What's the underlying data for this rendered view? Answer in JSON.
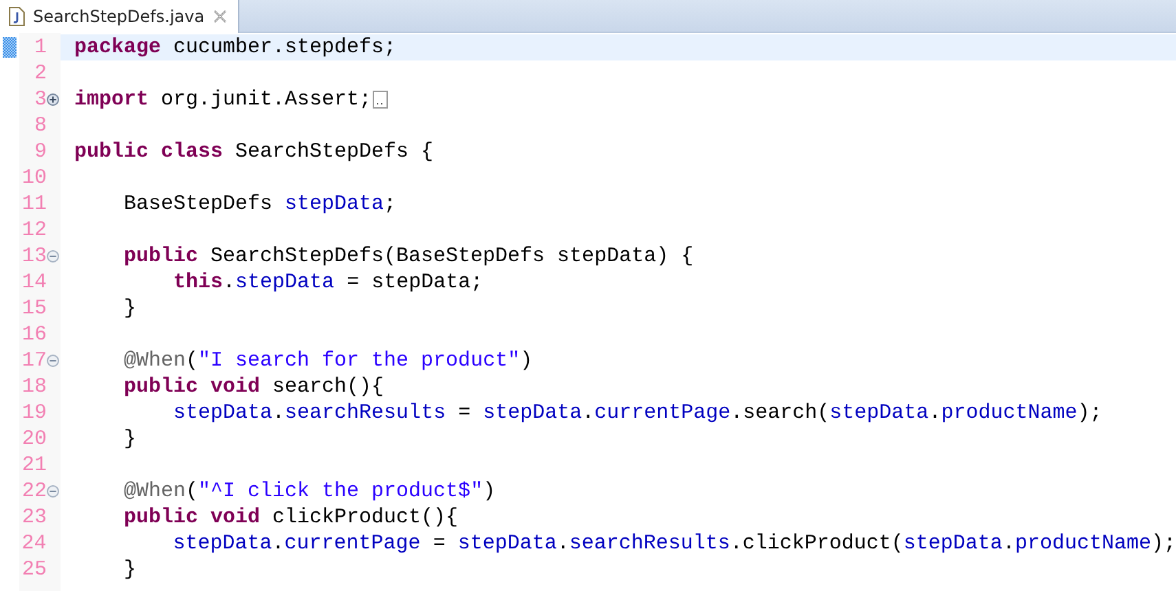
{
  "tabs": [
    {
      "title": "SearchStepDefs.java",
      "selected": true
    }
  ],
  "lines": [
    {
      "number": "1",
      "current": true,
      "tokens": [
        {
          "kind": "keyword",
          "text": "package"
        },
        {
          "kind": "plain",
          "text": " cucumber.stepdefs;"
        }
      ]
    },
    {
      "number": "2",
      "current": false
    },
    {
      "number": "3",
      "current": false,
      "collapsed": true,
      "tokens": [
        {
          "kind": "keyword",
          "text": "import"
        },
        {
          "kind": "plain",
          "text": " org.junit.Assert;"
        }
      ]
    },
    {
      "number": "8",
      "current": false
    },
    {
      "number": "9",
      "current": false,
      "tokens": [
        {
          "kind": "keyword",
          "text": "public class"
        },
        {
          "kind": "plain",
          "text": " SearchStepDefs {"
        }
      ]
    },
    {
      "number": "10",
      "current": false
    },
    {
      "number": "11",
      "current": false,
      "tokens": [
        {
          "kind": "plain",
          "text": "    BaseStepDefs "
        },
        {
          "kind": "field",
          "text": "stepData"
        },
        {
          "kind": "plain",
          "text": ";"
        }
      ]
    },
    {
      "number": "12",
      "current": false
    },
    {
      "number": "13",
      "current": false,
      "collapsed": false,
      "tokens": [
        {
          "kind": "keyword",
          "text": "    public"
        },
        {
          "kind": "plain",
          "text": " SearchStepDefs(BaseStepDefs stepData) {"
        }
      ]
    },
    {
      "number": "14",
      "current": false,
      "tokens": [
        {
          "kind": "keyword",
          "text": "        this"
        },
        {
          "kind": "plain",
          "text": "."
        },
        {
          "kind": "field",
          "text": "stepData"
        },
        {
          "kind": "plain",
          "text": " = stepData;"
        }
      ]
    },
    {
      "number": "15",
      "current": false,
      "tokens": [
        {
          "kind": "plain",
          "text": "    }"
        }
      ]
    },
    {
      "number": "16",
      "current": false
    },
    {
      "number": "17",
      "current": false,
      "collapsed": false,
      "tokens": [
        {
          "kind": "annotation",
          "text": "    @When"
        },
        {
          "kind": "plain",
          "text": "("
        },
        {
          "kind": "string",
          "text": "\"I search for the product\""
        },
        {
          "kind": "plain",
          "text": ")"
        }
      ]
    },
    {
      "number": "18",
      "current": false,
      "tokens": [
        {
          "kind": "keyword",
          "text": "    public void"
        },
        {
          "kind": "plain",
          "text": " search(){"
        }
      ]
    },
    {
      "number": "19",
      "current": false,
      "tokens": [
        {
          "kind": "field",
          "text": "        stepData"
        },
        {
          "kind": "plain",
          "text": "."
        },
        {
          "kind": "field",
          "text": "searchResults"
        },
        {
          "kind": "plain",
          "text": " = "
        },
        {
          "kind": "field",
          "text": "stepData"
        },
        {
          "kind": "plain",
          "text": "."
        },
        {
          "kind": "field",
          "text": "currentPage"
        },
        {
          "kind": "plain",
          "text": ".search("
        },
        {
          "kind": "field",
          "text": "stepData"
        },
        {
          "kind": "plain",
          "text": "."
        },
        {
          "kind": "field",
          "text": "productName"
        },
        {
          "kind": "plain",
          "text": ");"
        }
      ]
    },
    {
      "number": "20",
      "current": false,
      "tokens": [
        {
          "kind": "plain",
          "text": "    }"
        }
      ]
    },
    {
      "number": "21",
      "current": false
    },
    {
      "number": "22",
      "current": false,
      "collapsed": false,
      "tokens": [
        {
          "kind": "annotation",
          "text": "    @When"
        },
        {
          "kind": "plain",
          "text": "("
        },
        {
          "kind": "string",
          "text": "\"^I click the product$\""
        },
        {
          "kind": "plain",
          "text": ")"
        }
      ]
    },
    {
      "number": "23",
      "current": false,
      "tokens": [
        {
          "kind": "keyword",
          "text": "    public void"
        },
        {
          "kind": "plain",
          "text": " clickProduct(){"
        }
      ]
    },
    {
      "number": "24",
      "current": false,
      "tokens": [
        {
          "kind": "field",
          "text": "        stepData"
        },
        {
          "kind": "plain",
          "text": "."
        },
        {
          "kind": "field",
          "text": "currentPage"
        },
        {
          "kind": "plain",
          "text": " = "
        },
        {
          "kind": "field",
          "text": "stepData"
        },
        {
          "kind": "plain",
          "text": "."
        },
        {
          "kind": "field",
          "text": "searchResults"
        },
        {
          "kind": "plain",
          "text": ".clickProduct("
        },
        {
          "kind": "field",
          "text": "stepData"
        },
        {
          "kind": "plain",
          "text": "."
        },
        {
          "kind": "field",
          "text": "productName"
        },
        {
          "kind": "plain",
          "text": ");"
        }
      ]
    },
    {
      "number": "25",
      "current": false,
      "tokens": [
        {
          "kind": "plain",
          "text": "    }"
        }
      ]
    }
  ]
}
